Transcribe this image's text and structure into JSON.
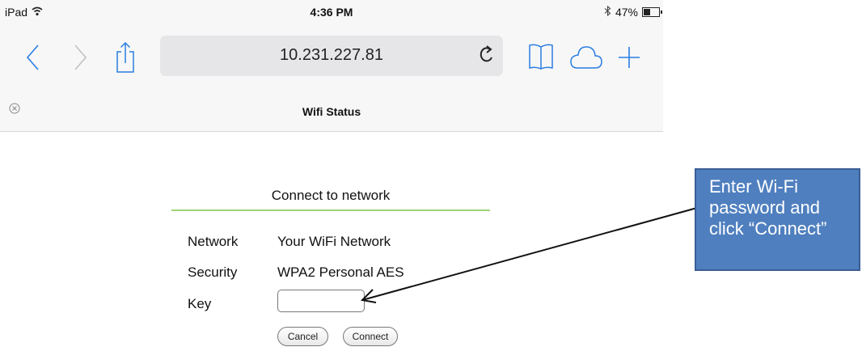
{
  "status_bar": {
    "device": "iPad",
    "time": "4:36 PM",
    "battery": "47%",
    "battery_level": 0.47
  },
  "toolbar": {
    "url": "10.231.227.81",
    "icons": [
      "back-chevron-icon",
      "forward-chevron-icon",
      "share-icon",
      "reload-icon",
      "bookmarks-icon",
      "icloud-tabs-icon",
      "new-tab-plus-icon"
    ]
  },
  "tab": {
    "title": "Wifi Status"
  },
  "form": {
    "title": "Connect to network",
    "network_label": "Network",
    "network_value": "Your WiFi Network",
    "security_label": "Security",
    "security_value": "WPA2 Personal AES",
    "key_label": "Key",
    "key_value": "",
    "cancel_label": "Cancel",
    "connect_label": "Connect"
  },
  "callout": {
    "text": "Enter Wi-Fi\npassword and\nclick “Connect”"
  },
  "colors": {
    "divider": "#9fd27a",
    "callout_fill": "#4f7fbf",
    "callout_border": "#3a5f94"
  }
}
